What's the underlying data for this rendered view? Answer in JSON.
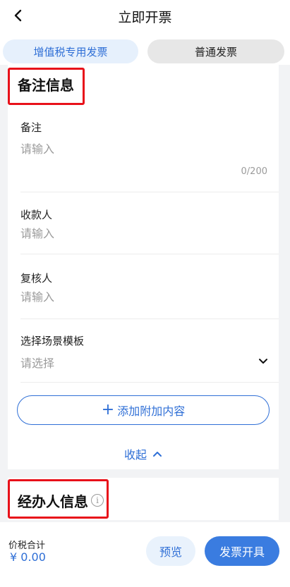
{
  "header": {
    "title": "立即开票",
    "back_icon": "chevron-left-icon"
  },
  "tabs": [
    {
      "label": "增值税专用发票",
      "active": true
    },
    {
      "label": "普通发票",
      "active": false
    }
  ],
  "remarks_section": {
    "title": "备注信息",
    "remark": {
      "label": "备注",
      "placeholder": "请输入",
      "counter": "0/200"
    },
    "payee": {
      "label": "收款人",
      "placeholder": "请输入"
    },
    "reviewer": {
      "label": "复核人",
      "placeholder": "请输入"
    },
    "template": {
      "label": "选择场景模板",
      "placeholder": "请选择"
    },
    "add_button": "添加附加内容",
    "collapse": "收起"
  },
  "handler_section": {
    "title": "经办人信息",
    "info_icon": "info-icon"
  },
  "footer": {
    "total_label": "价税合计",
    "total_value": "¥ 0.00",
    "preview_button": "预览",
    "issue_button": "发票开具"
  },
  "colors": {
    "accent": "#2f6fd6",
    "highlight": "#e8111a",
    "primary_button": "#3a7ce0"
  }
}
